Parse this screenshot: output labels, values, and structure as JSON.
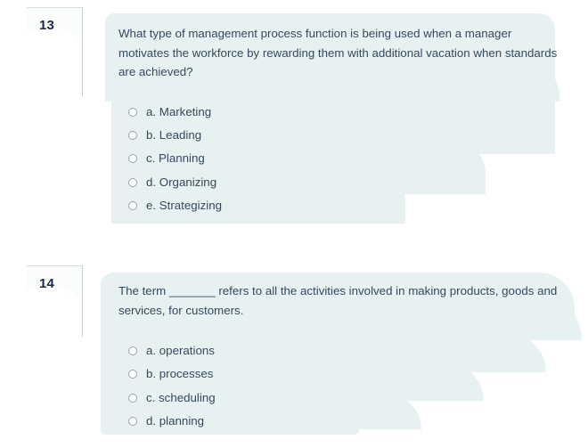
{
  "quiz": {
    "questions": [
      {
        "number": "13",
        "text": "What type of management process function is being used when a manager motivates the workforce by rewarding them with additional vacation when standards are achieved?",
        "options": [
          {
            "label": "a. Marketing",
            "selected": false
          },
          {
            "label": "b. Leading",
            "selected": false
          },
          {
            "label": "c. Planning",
            "selected": false
          },
          {
            "label": "d. Organizing",
            "selected": false
          },
          {
            "label": "e. Strategizing",
            "selected": false
          }
        ]
      },
      {
        "number": "14",
        "text": "The term _______ refers to all the activities involved in making products, goods and services, for customers.",
        "options": [
          {
            "label": "a. operations",
            "selected": false
          },
          {
            "label": "b. processes",
            "selected": false
          },
          {
            "label": "c. scheduling",
            "selected": false
          },
          {
            "label": "d. planning",
            "selected": false
          }
        ]
      }
    ]
  },
  "colors": {
    "page_background": "#ffffff",
    "highlight": "#e7f1f1",
    "text": "#34495e",
    "number_text": "#1b2b40",
    "card_background": "#fbfcfc",
    "card_border": "#c8cfd4",
    "radio_border": "#9aa6ad"
  }
}
